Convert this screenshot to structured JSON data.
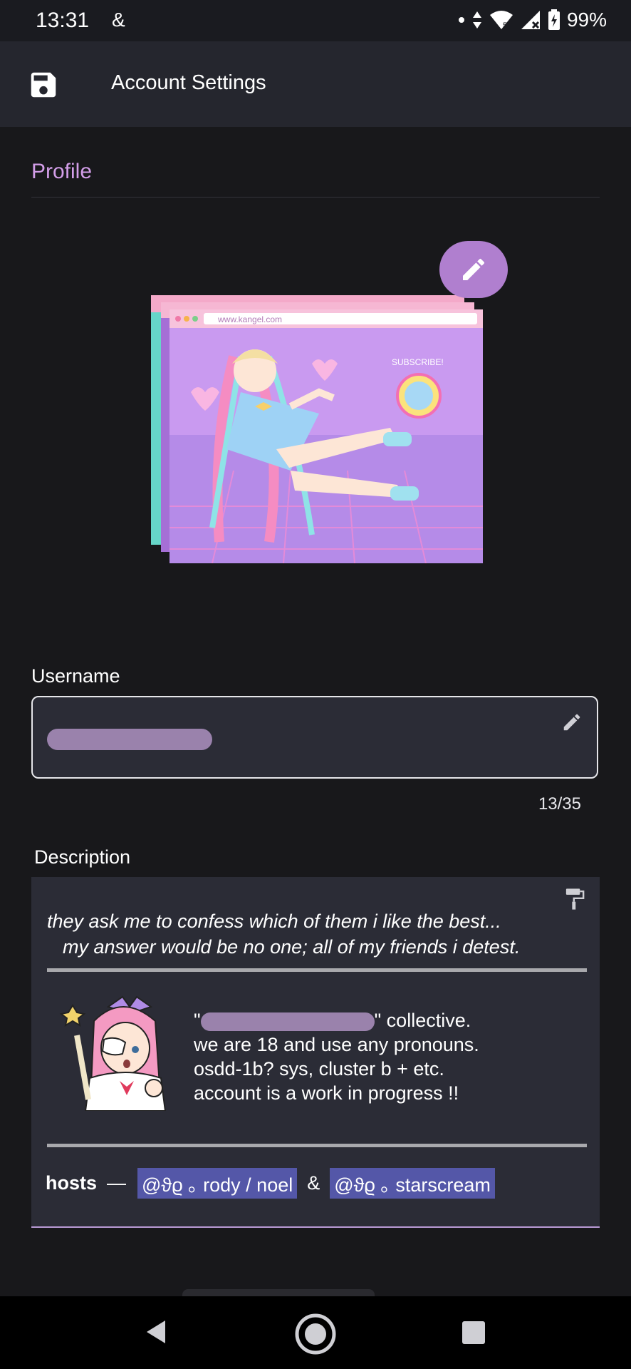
{
  "status_bar": {
    "time": "13:31",
    "notification": "&",
    "battery": "99%",
    "wifi_badge": "5",
    "icons": [
      "dot-icon",
      "data-arrows-icon",
      "wifi-icon",
      "signal-icon",
      "battery-charging-icon"
    ]
  },
  "app_bar": {
    "title": "Account Settings",
    "icon": "save-icon"
  },
  "profile": {
    "section_title": "Profile",
    "avatar": {
      "url_bar_text": "www.kangel.com",
      "subscribe_text": "SUBSCRIBE!"
    },
    "edit_icon": "pencil-icon"
  },
  "username": {
    "label": "Username",
    "value_hidden": true,
    "counter": "13/35",
    "edit_icon": "pencil-icon"
  },
  "description": {
    "label": "Description",
    "quote_line1": "they ask me to confess which of them i like the best...",
    "quote_line2": "my answer would be no one; all of my friends i detest.",
    "bio_line1_prefix": "\"",
    "bio_line1_suffix": "\" collective.",
    "bio_line2": "we are 18 and use any pronouns.",
    "bio_line3": "osdd-1b? sys, cluster b + etc.",
    "bio_line4": "account is a work in progress !!",
    "hosts_label": "hosts",
    "hosts_dash": "—",
    "host1": "@ϑϱ ｡ rody / noel",
    "amp": "&",
    "host2": "@ϑϱ ｡ starscream",
    "icon": "paint-roller-icon"
  },
  "nav_bar": {
    "icons": [
      "back-icon",
      "home-icon",
      "recents-icon"
    ]
  },
  "colors": {
    "accent": "#d39ee9",
    "fab": "#b07fcf",
    "tag_bg": "#5457a8",
    "field_bg": "#2b2c36"
  }
}
